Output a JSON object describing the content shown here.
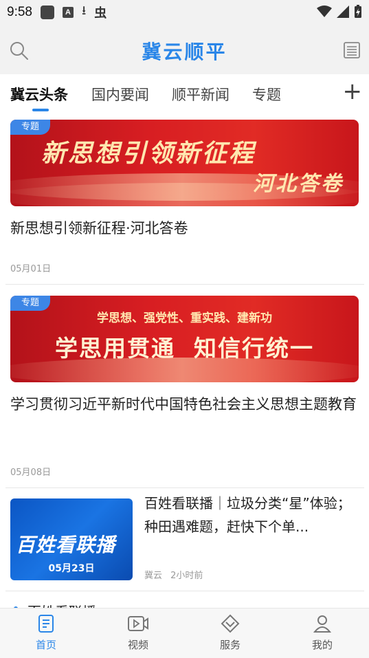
{
  "status_bar": {
    "time": "9:58",
    "icons": [
      "square-icon",
      "a-badge-icon",
      "download-icon",
      "bug-icon",
      "wifi-icon",
      "signal-icon",
      "battery-icon"
    ],
    "badge_letter": "A"
  },
  "header": {
    "title": "冀云顺平",
    "search_icon": "search-icon",
    "menu_icon": "newspaper-icon"
  },
  "tabs": [
    {
      "label": "冀云头条",
      "active": true
    },
    {
      "label": "国内要闻",
      "active": false
    },
    {
      "label": "顺平新闻",
      "active": false
    },
    {
      "label": "专题",
      "active": false
    }
  ],
  "tabs_add_label": "+",
  "articles": [
    {
      "tag": "专题",
      "banner_line1": "新思想引领新征程",
      "banner_line2": "河北答卷",
      "title": "新思想引领新征程·河北答卷",
      "date": "05月01日"
    },
    {
      "tag": "专题",
      "banner_line1": "学思想、强党性、重实践、建新功",
      "banner_line2": "学思用贯通  知信行统一",
      "title": "学习贯彻习近平新时代中国特色社会主义思想主题教育",
      "date": "05月08日"
    },
    {
      "thumb_logo": "百姓看联播",
      "thumb_date": "05月23日",
      "title": "百姓看联播｜垃圾分类“星”体验；种田遇难题，赶快下个单...",
      "source": "冀云",
      "time": "2小时前"
    }
  ],
  "next_section_peek": "百姓看联播",
  "bottom_nav": [
    {
      "label": "首页",
      "icon": "home-icon",
      "active": true
    },
    {
      "label": "视频",
      "icon": "video-icon",
      "active": false
    },
    {
      "label": "服务",
      "icon": "service-icon",
      "active": false
    },
    {
      "label": "我的",
      "icon": "user-icon",
      "active": false
    }
  ],
  "colors": {
    "accent": "#2a86e8",
    "banner_red": "#d81e22",
    "tag_blue": "#3d86e6"
  }
}
